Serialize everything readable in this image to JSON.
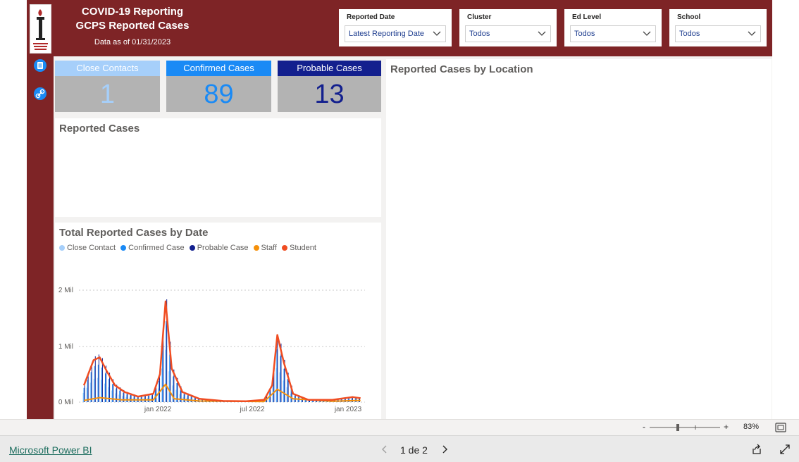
{
  "header": {
    "title_line1": "COVID-19 Reporting",
    "title_line2": "GCPS Reported Cases",
    "as_of": "Data as of  01/31/2023"
  },
  "slicers": [
    {
      "label": "Reported Date",
      "value": "Latest Reporting Date"
    },
    {
      "label": "Cluster",
      "value": "Todos"
    },
    {
      "label": "Ed Level",
      "value": "Todos"
    },
    {
      "label": "School",
      "value": "Todos"
    }
  ],
  "cards": [
    {
      "label": "Close Contacts",
      "value": "1",
      "head_color": "#a6cffa",
      "value_color": "#a6cffa"
    },
    {
      "label": "Confirmed Cases",
      "value": "89",
      "head_color": "#1a8af5",
      "value_color": "#1a8af5"
    },
    {
      "label": "Probable Cases",
      "value": "13",
      "head_color": "#13208e",
      "value_color": "#13208e"
    }
  ],
  "panels": {
    "reported_cases_title": "Reported Cases",
    "by_location_title": "Reported Cases by Location",
    "by_date_title": "Total Reported Cases by Date"
  },
  "chart_data": {
    "type": "line",
    "title": "Total Reported Cases by Date",
    "y_ticks": [
      "2 Mil",
      "1 Mil",
      "0 Mil"
    ],
    "x_ticks": [
      "jan 2022",
      "jul 2022",
      "jan 2023"
    ],
    "ylim": [
      0,
      2000
    ],
    "grid": true,
    "legend_position": "top",
    "legend": [
      {
        "name": "Close Contact",
        "color": "#a6cffa"
      },
      {
        "name": "Confirmed Case",
        "color": "#1a8af5"
      },
      {
        "name": "Probable Case",
        "color": "#13208e"
      },
      {
        "name": "Staff",
        "color": "#f5900a"
      },
      {
        "name": "Student",
        "color": "#f04d22"
      }
    ],
    "series": [
      {
        "name": "Student",
        "x": [
          "2021-08-01",
          "2021-08-20",
          "2021-09-01",
          "2021-09-15",
          "2021-10-01",
          "2021-10-20",
          "2021-11-15",
          "2021-12-15",
          "2021-12-28",
          "2022-01-08",
          "2022-01-20",
          "2022-02-10",
          "2022-03-15",
          "2022-05-01",
          "2022-06-15",
          "2022-07-20",
          "2022-08-05",
          "2022-08-15",
          "2022-08-28",
          "2022-09-15",
          "2022-10-15",
          "2022-12-01",
          "2023-01-10",
          "2023-01-25"
        ],
        "values": [
          300,
          750,
          800,
          550,
          300,
          180,
          100,
          150,
          500,
          1800,
          600,
          180,
          60,
          20,
          15,
          40,
          300,
          1200,
          700,
          150,
          40,
          40,
          90,
          70
        ]
      },
      {
        "name": "Staff",
        "x": [
          "2021-08-01",
          "2021-09-01",
          "2021-10-15",
          "2021-12-15",
          "2022-01-08",
          "2022-01-25",
          "2022-03-15",
          "2022-07-20",
          "2022-08-15",
          "2022-09-15",
          "2022-12-01",
          "2023-01-25"
        ],
        "values": [
          30,
          80,
          40,
          40,
          320,
          60,
          20,
          10,
          230,
          60,
          15,
          30
        ]
      }
    ]
  },
  "bottom_bar": {
    "zoom_minus": "-",
    "zoom_plus": "+",
    "zoom": "83%"
  },
  "footer": {
    "link": "Microsoft Power BI",
    "page_indicator": "1 de 2"
  },
  "icons": [
    "logo-icon",
    "document-icon",
    "link-icon",
    "chevron-down-icon",
    "fit-page-icon",
    "share-icon",
    "expand-icon",
    "chevron-left-icon",
    "chevron-right-icon"
  ]
}
